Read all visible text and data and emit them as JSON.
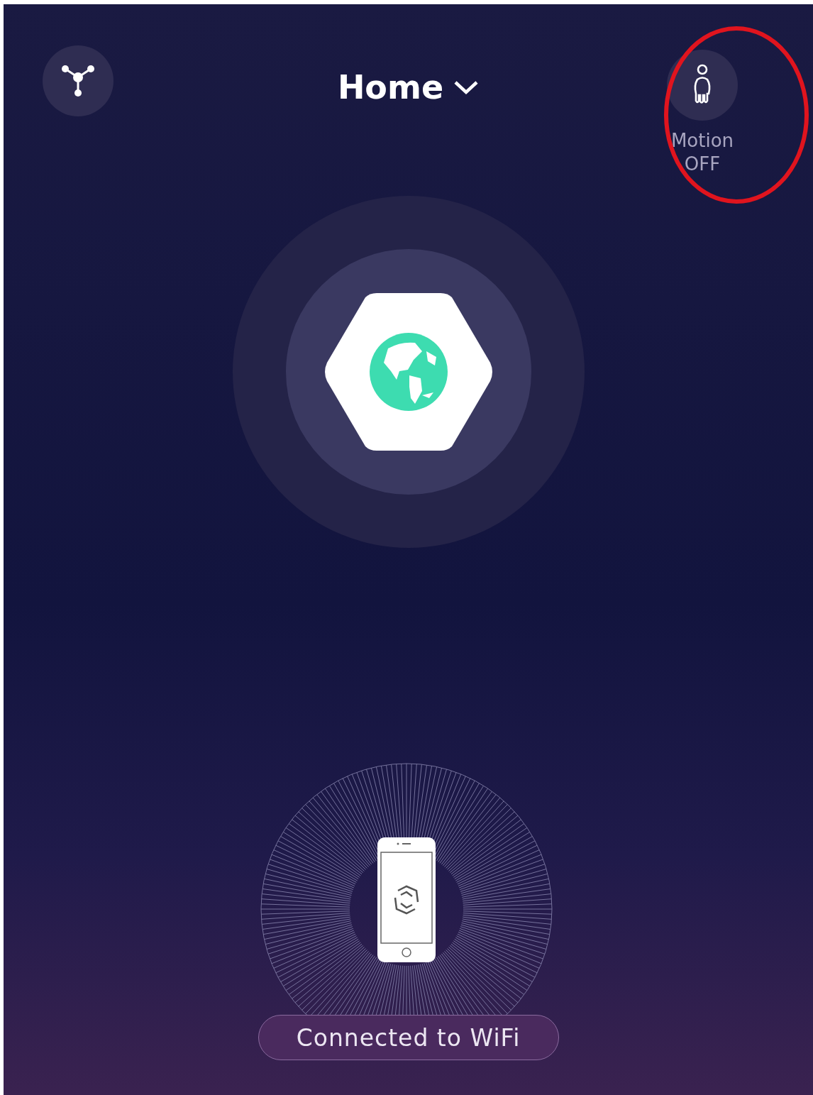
{
  "header": {
    "title": "Home",
    "motion": {
      "label": "Motion",
      "status": "OFF"
    }
  },
  "status": {
    "label": "Connected to WiFi"
  }
}
